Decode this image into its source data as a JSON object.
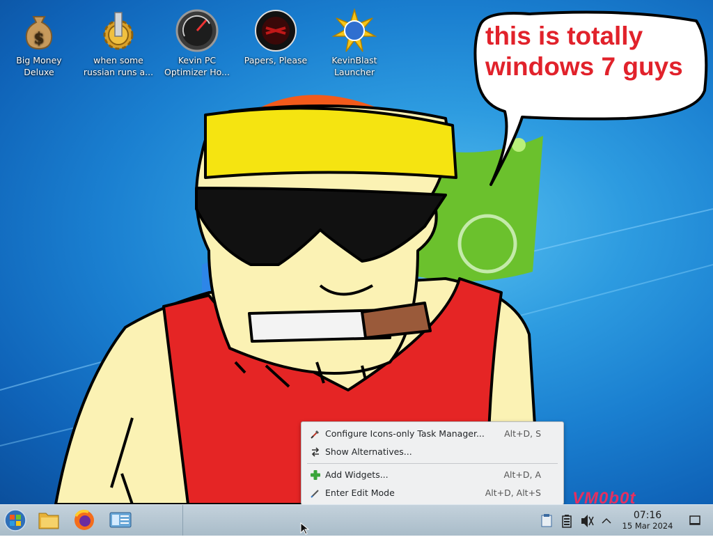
{
  "desktop": {
    "icons": [
      {
        "label_line1": "Big Money",
        "label_line2": "Deluxe",
        "icon": "money-bag-icon"
      },
      {
        "label_line1": "when some",
        "label_line2": "russian runs a...",
        "icon": "gear-icon"
      },
      {
        "label_line1": "Kevin PC",
        "label_line2": "Optimizer Ho...",
        "icon": "speedometer-icon"
      },
      {
        "label_line1": "Papers, Please",
        "label_line2": "",
        "icon": "papers-please-icon"
      },
      {
        "label_line1": "KevinBlast",
        "label_line2": "Launcher",
        "icon": "starburst-globe-icon"
      }
    ]
  },
  "wallpaper": {
    "speech_bubble_line1": "this is totally",
    "speech_bubble_line2": "windows 7 guys",
    "watermark": "VM0b0t"
  },
  "context_menu": {
    "items": [
      {
        "label": "Configure Icons-only Task Manager...",
        "shortcut": "Alt+D, S",
        "icon": "configure-tools-icon"
      },
      {
        "label": "Show Alternatives...",
        "shortcut": "",
        "icon": "alternatives-icon"
      },
      {
        "label": "Add Widgets...",
        "shortcut": "Alt+D, A",
        "icon": "add-plus-icon"
      },
      {
        "label": "Enter Edit Mode",
        "shortcut": "Alt+D, Alt+S",
        "icon": "edit-pen-icon"
      }
    ]
  },
  "taskbar": {
    "start": "windows-orb-icon",
    "pinned": [
      "file-manager-icon",
      "firefox-icon",
      "system-settings-icon"
    ],
    "tray": [
      "clipboard-icon",
      "battery-icon",
      "volume-muted-icon",
      "chevron-up-icon"
    ],
    "clock_time": "07:16",
    "clock_date": "15 Mar 2024",
    "show_desktop": "show-desktop-icon"
  },
  "colors": {
    "speech_text": "#e1222b",
    "watermark": "#e43060",
    "menu_bg": "#eff0f1"
  }
}
